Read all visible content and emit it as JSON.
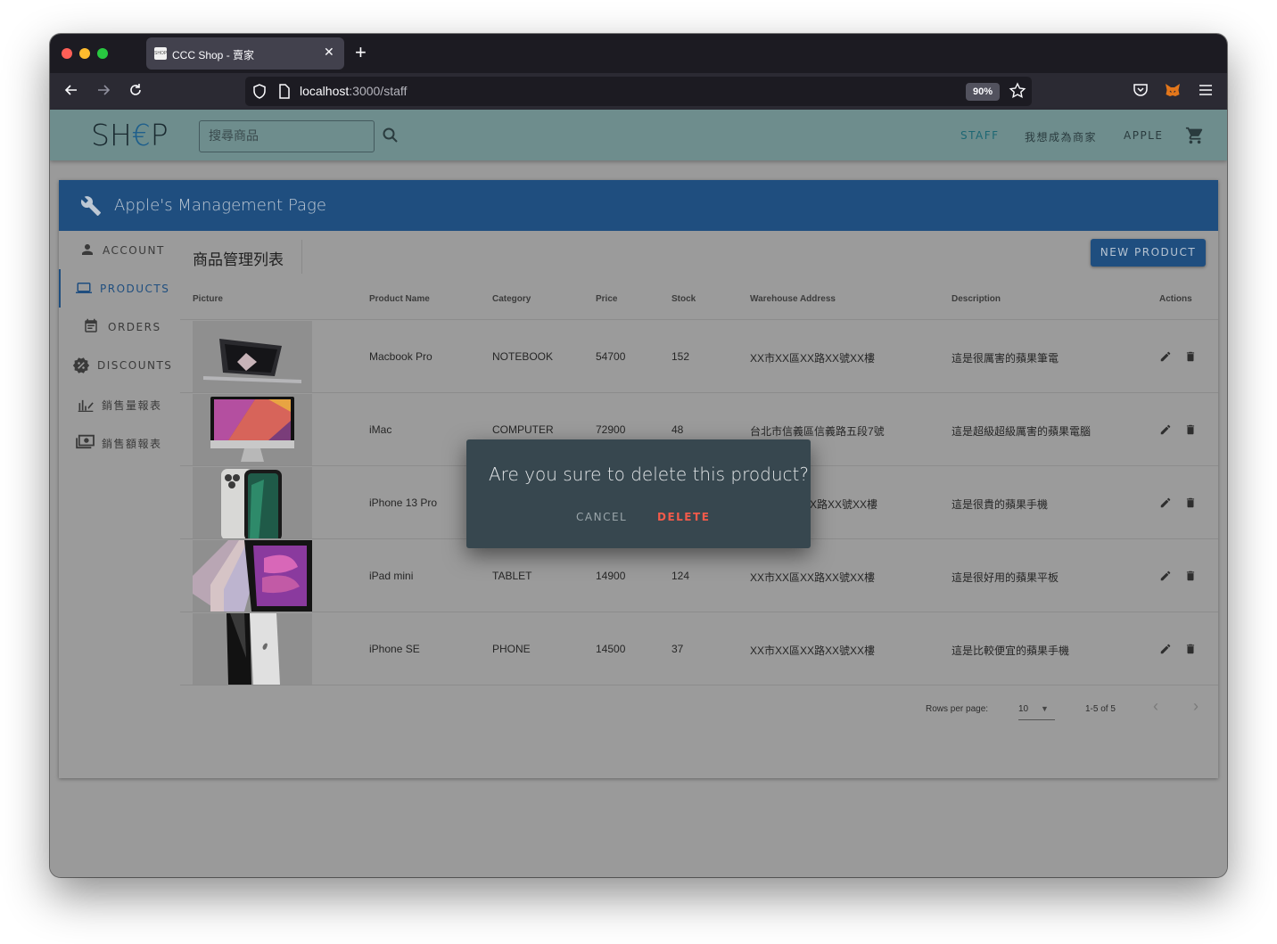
{
  "browser": {
    "tab_title": "CCC Shop - 賣家",
    "favicon_text": "SHOP",
    "url_host": "localhost",
    "url_path": ":3000/staff",
    "zoom": "90%"
  },
  "header": {
    "logo_prefix": "SH",
    "logo_middle": "€",
    "logo_suffix": "P",
    "search_placeholder": "搜尋商品",
    "links": {
      "staff": "STAFF",
      "become_seller": "我想成為商家",
      "user": "APPLE"
    }
  },
  "card": {
    "title": "Apple's Management Page"
  },
  "sidebar": {
    "items": [
      {
        "label": "ACCOUNT"
      },
      {
        "label": "PRODUCTS"
      },
      {
        "label": "ORDERS"
      },
      {
        "label": "DISCOUNTS"
      },
      {
        "label": "銷售量報表"
      },
      {
        "label": "銷售額報表"
      }
    ]
  },
  "main": {
    "title": "商品管理列表",
    "new_product": "NEW PRODUCT"
  },
  "table": {
    "columns": [
      "Picture",
      "Product Name",
      "Category",
      "Price",
      "Stock",
      "Warehouse Address",
      "Description",
      "Actions"
    ],
    "rows": [
      {
        "name": "Macbook Pro",
        "category": "NOTEBOOK",
        "price": "54700",
        "stock": "152",
        "address": "XX市XX區XX路XX號XX樓",
        "description": "這是很厲害的蘋果筆電"
      },
      {
        "name": "iMac",
        "category": "COMPUTER",
        "price": "72900",
        "stock": "48",
        "address": "台北市信義區信義路五段7號",
        "description": "這是超級超級厲害的蘋果電腦"
      },
      {
        "name": "iPhone 13 Pro",
        "category": "",
        "price": "",
        "stock": "",
        "address": "X路XX號XX樓",
        "description": "這是很貴的蘋果手機"
      },
      {
        "name": "iPad mini",
        "category": "TABLET",
        "price": "14900",
        "stock": "124",
        "address": "XX市XX區XX路XX號XX樓",
        "description": "這是很好用的蘋果平板"
      },
      {
        "name": "iPhone SE",
        "category": "PHONE",
        "price": "14500",
        "stock": "37",
        "address": "XX市XX區XX路XX號XX樓",
        "description": "這是比較便宜的蘋果手機"
      }
    ]
  },
  "pagination": {
    "rows_per_page_label": "Rows per page:",
    "rows_per_page": "10",
    "range": "1-5 of 5"
  },
  "dialog": {
    "title": "Are you sure to delete this product?",
    "cancel": "CANCEL",
    "delete": "DELETE"
  }
}
